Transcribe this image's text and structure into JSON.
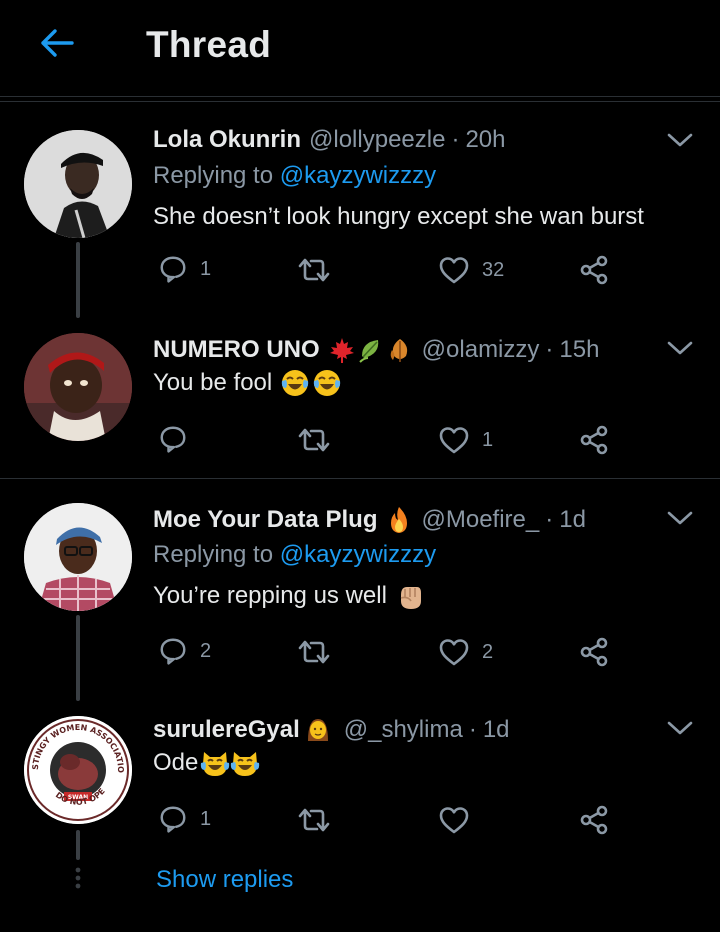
{
  "header": {
    "title": "Thread",
    "back_icon": "arrow-left-icon"
  },
  "colors": {
    "accent": "#1d9bf0",
    "muted": "#8b98a5",
    "text": "#e7e9ea",
    "background": "#000000"
  },
  "tweets": [
    {
      "name": "Lola Okunrin",
      "handle": "@lollypeezle",
      "dot": "·",
      "time": "20h",
      "replying_prefix": "Replying to",
      "replying_to": "@kayzywizzzy",
      "text": "She doesn’t look hungry except she wan burst",
      "replies": "1",
      "retweets": "",
      "likes": "32"
    },
    {
      "name": "NUMERO UNO",
      "name_emojis": [
        "maple-leaf",
        "leaf-fluttering",
        "fallen-leaf"
      ],
      "handle": "@olamizzy",
      "dot": "·",
      "time": "15h",
      "text": "You be fool",
      "text_emojis": [
        "face-with-tears-of-joy",
        "face-with-tears-of-joy"
      ],
      "replies": "",
      "retweets": "",
      "likes": "1"
    },
    {
      "name": "Moe Your Data Plug",
      "name_emojis": [
        "fire"
      ],
      "handle": "@Moefire_",
      "dot": "·",
      "time": "1d",
      "replying_prefix": "Replying to",
      "replying_to": "@kayzywizzzy",
      "text": "You’re repping us well",
      "text_emojis": [
        "raised-fist"
      ],
      "replies": "2",
      "retweets": "",
      "likes": "2"
    },
    {
      "name": "surulereGyal",
      "name_emojis": [
        "woman"
      ],
      "handle": "@_shylima",
      "dot": "·",
      "time": "1d",
      "text": "Ode",
      "text_emojis": [
        "grinning-cat-with-tears-of-joy",
        "grinning-cat-with-tears-of-joy"
      ],
      "replies": "1",
      "retweets": "",
      "likes": "",
      "avatar_text": {
        "top": "STINGY WOMEN ASSOCIATION OF NIGERIA",
        "middle": "SWAN",
        "bottom": "DO NOT OPEN"
      }
    }
  ],
  "show_replies": "Show replies"
}
